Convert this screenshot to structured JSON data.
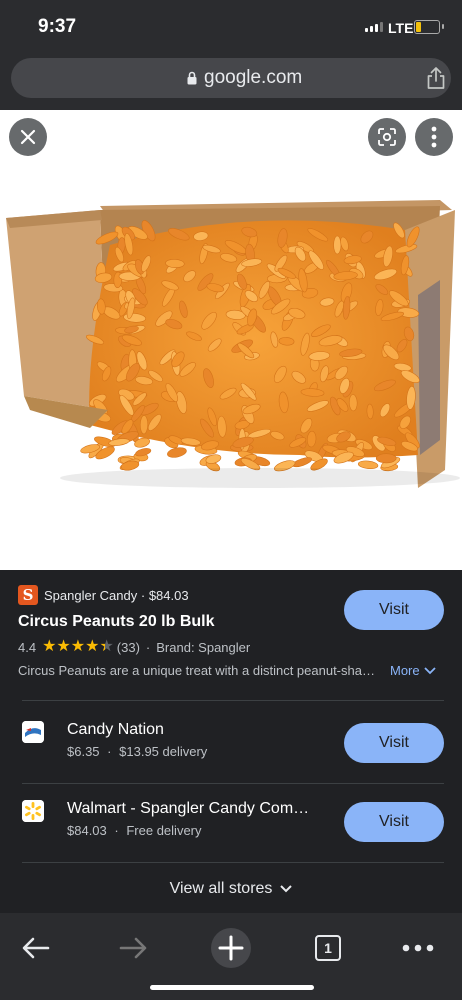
{
  "status_bar": {
    "time": "9:37",
    "network": "LTE",
    "battery_level": 0.25
  },
  "browser": {
    "url": "google.com"
  },
  "image_viewer": {
    "close_label": "Close",
    "lens_label": "Search with Lens",
    "menu_label": "More options",
    "product_image_alt": "Open cardboard box filled with orange circus peanut candies"
  },
  "product": {
    "store": "Spangler Candy",
    "store_logo_letter": "S",
    "price": "$84.03",
    "title": "Circus Peanuts 20 lb Bulk",
    "rating": "4.4",
    "rating_value": 4.4,
    "reviews": "(33)",
    "brand": "Brand: Spangler",
    "description": "Circus Peanuts are a unique treat with a distinct peanut-shaped design and fluffy texture",
    "more_label": "More",
    "visit_label": "Visit",
    "separator": "·"
  },
  "stores": [
    {
      "name": "Candy Nation",
      "price": "$6.35",
      "delivery": "$13.95 delivery",
      "visit_label": "Visit"
    },
    {
      "name": "Walmart - Spangler Candy Company Circus Peanuts",
      "price": "$84.03",
      "delivery": "Free delivery",
      "visit_label": "Visit"
    }
  ],
  "view_all_label": "View all stores",
  "toolbar": {
    "tab_count": "1"
  },
  "colors": {
    "accent": "#8ab4f8",
    "star": "#fbbc04",
    "background": "#202124",
    "chrome": "#2b2c2f"
  }
}
